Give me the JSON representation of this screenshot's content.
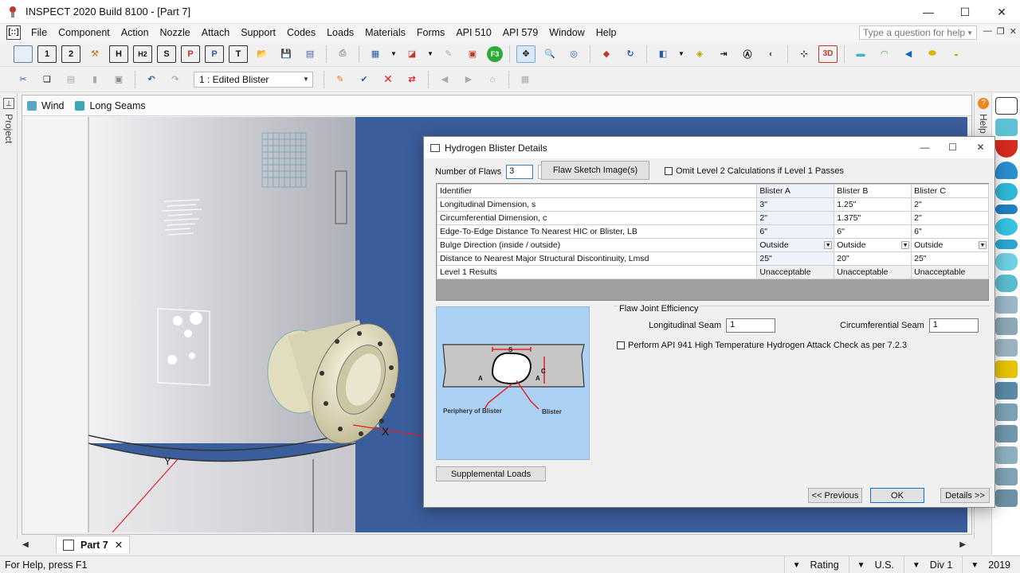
{
  "app": {
    "title": "INSPECT 2020 Build 8100 - [Part 7]",
    "doc_icon_label": "[::]",
    "window_buttons": [
      "—",
      "☐",
      "✕"
    ]
  },
  "menu": {
    "items": [
      "File",
      "Component",
      "Action",
      "Nozzle",
      "Attach",
      "Support",
      "Codes",
      "Loads",
      "Materials",
      "Forms",
      "API 510",
      "API 579",
      "Window",
      "Help"
    ],
    "help_placeholder": "Type a question for help",
    "mdi_buttons": [
      "—",
      "❐",
      "✕"
    ]
  },
  "toolbar1": {
    "labels": [
      "1",
      "2",
      "H",
      "H2",
      "S",
      "P",
      "P",
      "T",
      "F3",
      "3D"
    ]
  },
  "toolbar2": {
    "combo_value": "1 : Edited Blister"
  },
  "left_strip": {
    "label": "Project"
  },
  "right_strip": {
    "label": "Help",
    "q": "?"
  },
  "doc_tabs": [
    {
      "label": "Wind"
    },
    {
      "label": "Long Seams"
    }
  ],
  "viewport": {
    "axis_labels": [
      "Y",
      "X"
    ]
  },
  "bottom": {
    "part_tab": "Part 7",
    "close": "✕"
  },
  "status": {
    "message": "For Help, press F1",
    "cells": [
      "Rating",
      "U.S.",
      "Div 1",
      "2019"
    ]
  },
  "dialog": {
    "title": "Hydrogen Blister Details",
    "num_flaws_label": "Number of Flaws",
    "num_flaws_value": "3",
    "sketch_button": "Flaw Sketch Image(s)",
    "omit_label": "Omit Level 2 Calculations if Level 1 Passes",
    "table": {
      "headers": [
        "Identifier",
        "Blister A",
        "Blister B",
        "Blister C"
      ],
      "rows": [
        {
          "label": "Longitudinal Dimension, s",
          "a": "3\"",
          "b": "1.25\"",
          "c": "2\""
        },
        {
          "label": "Circumferential Dimension, c",
          "a": "2\"",
          "b": "1.375\"",
          "c": "2\""
        },
        {
          "label": "Edge-To-Edge Distance To Nearest HIC or Blister, LB",
          "a": "6\"",
          "b": "6\"",
          "c": "6\""
        },
        {
          "label": "Bulge Direction (inside / outside)",
          "a": "Outside",
          "b": "Outside",
          "c": "Outside"
        },
        {
          "label": "Distance to Nearest Major Structural Discontinuity, Lmsd",
          "a": "25\"",
          "b": "20\"",
          "c": "25\""
        },
        {
          "label": "Level 1 Results",
          "a": "Unacceptable",
          "b": "Unacceptable",
          "c": "Unacceptable"
        }
      ]
    },
    "sketch": {
      "periphery_label": "Periphery of Blister",
      "blister_label": "Blister",
      "s": "S",
      "c": "C",
      "a": "A"
    },
    "fje": {
      "title": "Flaw Joint Efficiency",
      "long_label": "Longitudinal Seam",
      "long_value": "1",
      "circ_label": "Circumferential Seam",
      "circ_value": "1"
    },
    "api_label": "Perform API 941 High Temperature Hydrogen Attack Check as per 7.2.3",
    "supp_button": "Supplemental Loads",
    "prev_button": "<< Previous",
    "ok_button": "OK",
    "details_button": "Details >>"
  },
  "colors": {
    "viewport_bg": "#3a5d9c",
    "vessel": "#cfcfd4",
    "flange": "#e8e4c8",
    "sketch_bg": "#abd1f5",
    "accent": "#0f6fcf"
  }
}
